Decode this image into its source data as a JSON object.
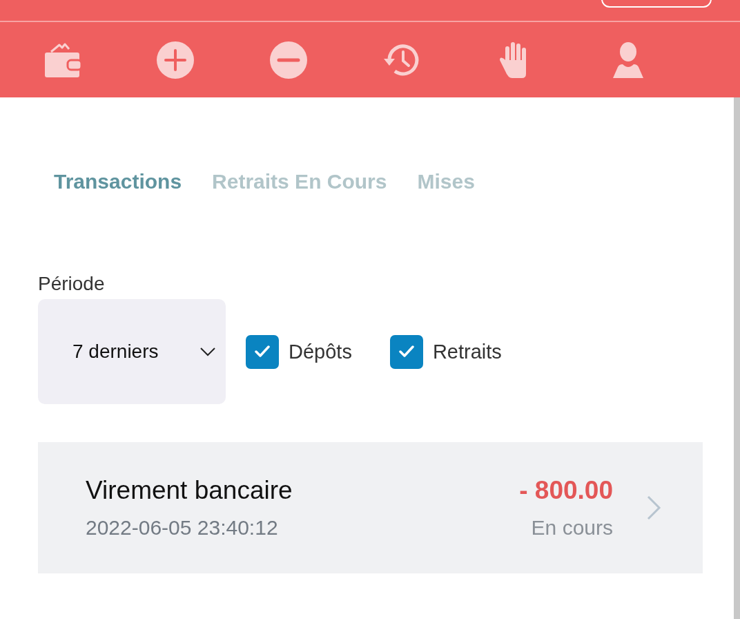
{
  "nav_icons": [
    {
      "kind": "wallet"
    },
    {
      "kind": "plus"
    },
    {
      "kind": "minus"
    },
    {
      "kind": "history"
    },
    {
      "kind": "hand"
    },
    {
      "kind": "user"
    }
  ],
  "tabs": [
    {
      "label": "Transactions",
      "selected": true
    },
    {
      "label": "Retraits En Cours",
      "selected": false
    },
    {
      "label": "Mises",
      "selected": false
    }
  ],
  "period": {
    "label": "Période",
    "value": "7 derniers"
  },
  "filters": [
    {
      "label": "Dépôts",
      "checked": true
    },
    {
      "label": "Retraits",
      "checked": true
    }
  ],
  "transactions": [
    {
      "title": "Virement bancaire",
      "date": "2022-06-05 23:40:12",
      "amount": "- 800.00",
      "status": "En cours"
    }
  ]
}
